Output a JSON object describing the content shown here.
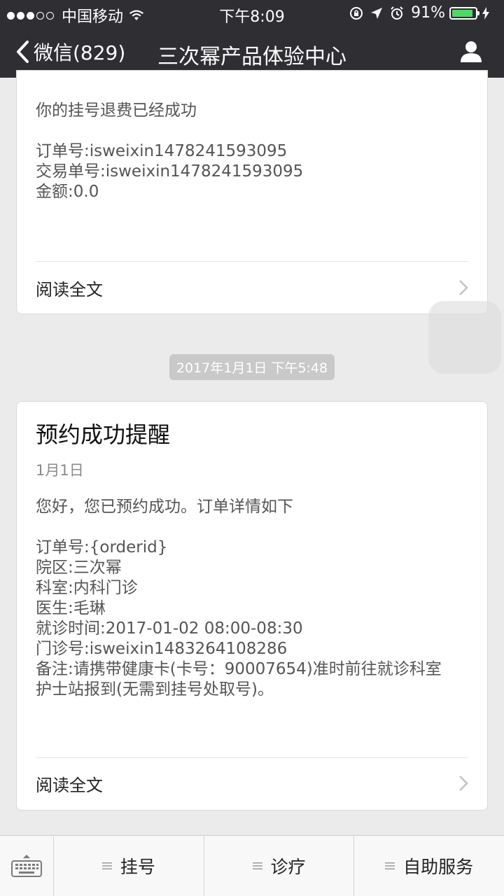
{
  "status_bar": {
    "carrier": "中国移动",
    "time": "下午8:09",
    "battery_percent": "91%",
    "battery_level": 0.91,
    "battery_color": "#4cd964"
  },
  "nav": {
    "back_label": "微信(829)",
    "title": "三次幂产品体验中心",
    "back_icon": "chevron-left-icon",
    "profile_icon": "person-icon"
  },
  "messages": [
    {
      "intro": "你的挂号退费已经成功",
      "lines": [
        "订单号:isweixin1478241593095",
        "交易单号:isweixin1478241593095",
        "金额:0.0"
      ],
      "read_more": "阅读全文"
    },
    {
      "timestamp": "2017年1月1日 下午5:48",
      "title": "预约成功提醒",
      "date": "1月1日",
      "intro": "您好，您已预约成功。订单详情如下",
      "lines": [
        "订单号:{orderid}",
        "院区:三次幂",
        "科室:内科门诊",
        "医生:毛琳",
        "就诊时间:2017-01-02 08:00-08:30",
        "门诊号:isweixin1483264108286",
        "备注:请携带健康卡(卡号：90007654)准时前往就诊科室",
        "护士站报到(无需到挂号处取号)。"
      ],
      "read_more": "阅读全文"
    }
  ],
  "bottom_menu": {
    "keyboard_icon": "keyboard-icon",
    "items": [
      {
        "label": "挂号"
      },
      {
        "label": "诊疗"
      },
      {
        "label": "自助服务"
      }
    ]
  }
}
